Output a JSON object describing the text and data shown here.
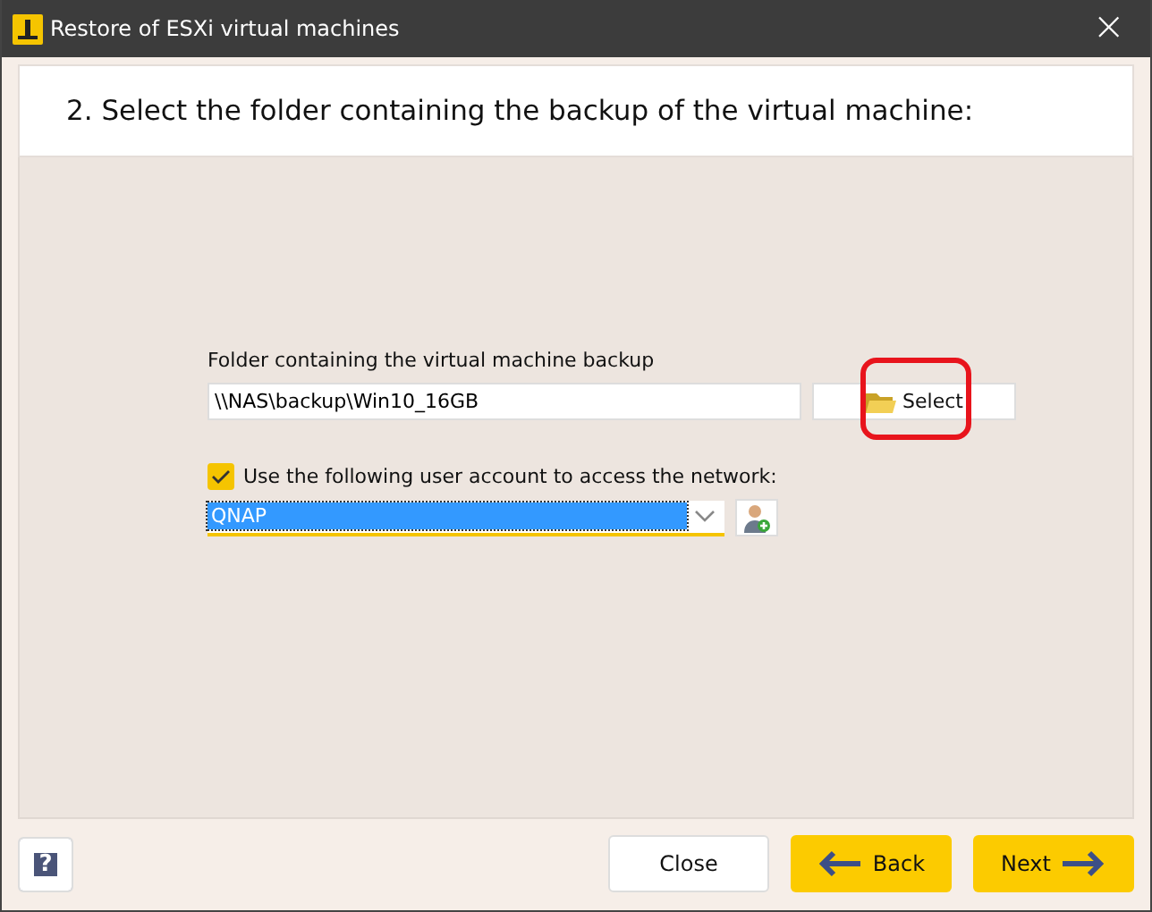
{
  "window": {
    "title": "Restore of ESXi virtual machines",
    "close": "×"
  },
  "step_title": "2. Select the folder containing the backup of the virtual machine:",
  "folder": {
    "label": "Folder containing the virtual machine backup",
    "value": "\\\\NAS\\backup\\Win10_16GB",
    "button": "Select",
    "highlighted": true
  },
  "account": {
    "label": "Use the following user account to access the network:",
    "checked": true,
    "value": "QNAP"
  },
  "footer": {
    "help": "?",
    "buttons": [
      {
        "label": "Close",
        "kind": "plain"
      },
      {
        "label": "Back",
        "kind": "back"
      },
      {
        "label": "Next",
        "kind": "next"
      }
    ]
  }
}
